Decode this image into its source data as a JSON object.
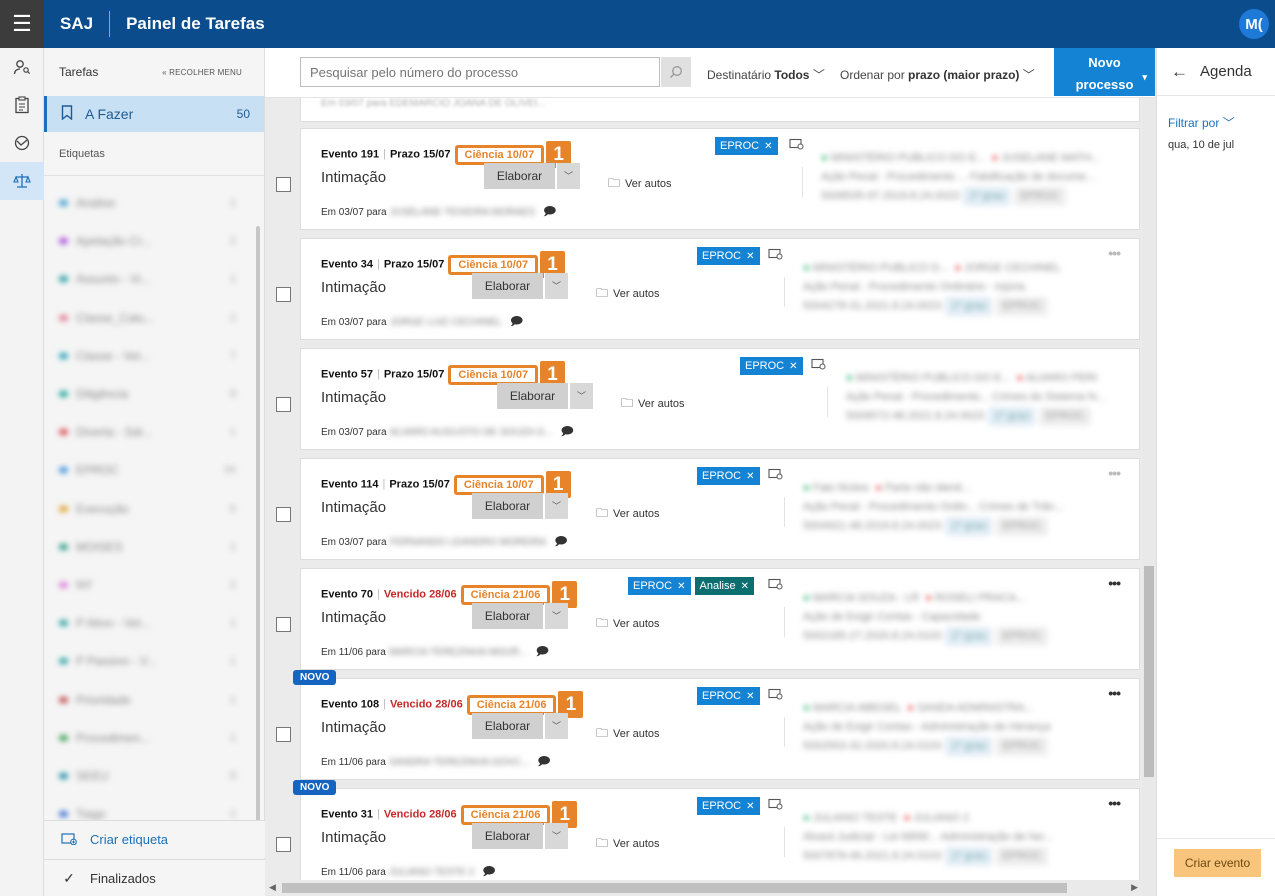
{
  "header": {
    "brand": "SAJ",
    "title": "Painel de Tarefas",
    "avatar": "M("
  },
  "sidebar": {
    "tarefas_label": "Tarefas",
    "collapse_label": "RECOLHER MENU",
    "todo": {
      "label": "A Fazer",
      "count": "50"
    },
    "etiquetas_label": "Etiquetas",
    "tags": [
      {
        "name": "Analise",
        "count": "1",
        "color": "#3f9bd1"
      },
      {
        "name": "Apelação Cr...",
        "count": "2",
        "color": "#a64bd8"
      },
      {
        "name": "Assunto - Vi...",
        "count": "1",
        "color": "#1a9aa3"
      },
      {
        "name": "Classe_Calu...",
        "count": "1",
        "color": "#e07a8a"
      },
      {
        "name": "Classe - Vel...",
        "count": "7",
        "color": "#22a0b0"
      },
      {
        "name": "Diligência",
        "count": "8",
        "color": "#1aa398"
      },
      {
        "name": "Diverta - Sál...",
        "count": "1",
        "color": "#d94a4a"
      },
      {
        "name": "EPROC",
        "count": "34",
        "color": "#3d8fe0"
      },
      {
        "name": "Execução",
        "count": "6",
        "color": "#e2a02a"
      },
      {
        "name": "MOISES",
        "count": "1",
        "color": "#2a9a8a"
      },
      {
        "name": "NY",
        "count": "2",
        "color": "#e07ad8"
      },
      {
        "name": "P Ativo - Vel...",
        "count": "1",
        "color": "#2aa0a0"
      },
      {
        "name": "P Passivo - V...",
        "count": "1",
        "color": "#2aa0a0"
      },
      {
        "name": "Prioridade",
        "count": "1",
        "color": "#c04848"
      },
      {
        "name": "Procedimen...",
        "count": "1",
        "color": "#3aa050"
      },
      {
        "name": "SEEU",
        "count": "8",
        "color": "#1a8aa0"
      },
      {
        "name": "Tiago",
        "count": "1",
        "color": "#3a6fd0"
      }
    ],
    "create_tag": "Criar etiqueta",
    "finished": "Finalizados"
  },
  "toolbar": {
    "search_placeholder": "Pesquisar pelo número do processo",
    "dest_label": "Destinatário",
    "dest_value": "Todos",
    "order_label": "Ordenar por",
    "order_value": "prazo (maior prazo)",
    "new_line1": "Novo",
    "new_line2": "processo"
  },
  "list": {
    "prev_strip": "Em 03/07 para EDEMARCIO JOANA DE OLIVEI...",
    "cards": [
      {
        "evento": "Evento 191",
        "prazo": "Prazo 15/07",
        "ciencia": "Ciência 10/07",
        "badge": "1",
        "title": "Intimação",
        "elaborar": "Elaborar",
        "ver_autos": "Ver autos",
        "em": "Em 03/07 para",
        "recipient": "JUSELANE TEIXEIRA MORAES",
        "chips": [
          "EPROC"
        ],
        "info1": "MINISTÉRIO PUBLICO DO E...",
        "info2": "JUSELANE MATH...",
        "info3": "Ação Penal - Procedimento ... Falsificação de docume...",
        "info4": "5008535-97.2019.8.24.0023",
        "pill1": "1º grau",
        "pill2": "EPROC"
      },
      {
        "evento": "Evento 34",
        "prazo": "Prazo 15/07",
        "ciencia": "Ciência 10/07",
        "badge": "1",
        "title": "Intimação",
        "elaborar": "Elaborar",
        "ver_autos": "Ver autos",
        "em": "Em 03/07 para",
        "recipient": "JORGE LUIZ CECHINEL",
        "chips": [
          "EPROC"
        ],
        "info1": "MINISTÉRIO PUBLICO D...",
        "info2": "JORGE CECHINEL",
        "info3": "Ação Penal - Procedimento Ordinário - Injúria",
        "info4": "5004278-31.2021.8.24.0023",
        "pill1": "1º grau",
        "pill2": "EPROC"
      },
      {
        "evento": "Evento 57",
        "prazo": "Prazo 15/07",
        "ciencia": "Ciência 10/07",
        "badge": "1",
        "title": "Intimação",
        "elaborar": "Elaborar",
        "ver_autos": "Ver autos",
        "em": "Em 03/07 para",
        "recipient": "ALVARO AUGUSTO DE SOUZA O...",
        "chips": [
          "EPROC"
        ],
        "info1": "MINISTÉRIO PUBLICO DO E...",
        "info2": "ALVARO PERI",
        "info3": "Ação Penal - Procedimento... Crimes do Sistema N...",
        "info4": "5009572-48.2021.8.24.0023",
        "pill1": "1º grau",
        "pill2": "EPROC"
      },
      {
        "evento": "Evento 114",
        "prazo": "Prazo 15/07",
        "ciencia": "Ciência 10/07",
        "badge": "1",
        "title": "Intimação",
        "elaborar": "Elaborar",
        "ver_autos": "Ver autos",
        "em": "Em 03/07 para",
        "recipient": "FERNANDO LEANDRO MOREIRA",
        "chips": [
          "EPROC"
        ],
        "info1": "Fato Ilícitos",
        "info2": "Parte não identi...",
        "info3": "Ação Penal - Procedimento Ordin... Crimes de Trân...",
        "info4": "5004921-48.2019.8.24.0023",
        "pill1": "1º grau",
        "pill2": "EPROC"
      },
      {
        "evento": "Evento 70",
        "prazo": "Vencido 28/06",
        "ciencia": "Ciência 21/06",
        "badge": "1",
        "title": "Intimação",
        "elaborar": "Elaborar",
        "ver_autos": "Ver autos",
        "em": "Em 11/06 para",
        "recipient": "MARCIA TEREZINHA MOUR...",
        "chips": [
          "EPROC",
          "Analise"
        ],
        "info1": "MARCIA SOUZA - LR",
        "info2": "ROSELI PRACA...",
        "info3": "Ação de Exigir Contas - Capacidade",
        "info4": "5002185-27.2020.8.24.0103",
        "pill1": "1º grau",
        "pill2": "EPROC"
      },
      {
        "evento": "Evento 108",
        "prazo": "Vencido 28/06",
        "ciencia": "Ciência 21/06",
        "badge": "1",
        "title": "Intimação",
        "elaborar": "Elaborar",
        "ver_autos": "Ver autos",
        "em": "Em 11/06 para",
        "recipient": "SANDRA TEREZINHA GOVC...",
        "chips": [
          "EPROC"
        ],
        "info1": "MARCIA ABEGEL",
        "info2": "SANDA ADMINISTRA...",
        "info3": "Ação de Exigir Contas - Administração de Herança",
        "info4": "5002553-32.2020.8.24.0103",
        "pill1": "1º grau",
        "pill2": "EPROC",
        "novo": "NOVO"
      },
      {
        "evento": "Evento 31",
        "prazo": "Vencido 28/06",
        "ciencia": "Ciência 21/06",
        "badge": "1",
        "title": "Intimação",
        "elaborar": "Elaborar",
        "ver_autos": "Ver autos",
        "em": "Em 11/06 para",
        "recipient": "JULIANO TESTE 2",
        "chips": [
          "EPROC"
        ],
        "info1": "JULIANO TESTE",
        "info2": "JULIANO 2",
        "info3": "Alvará Judicial - Lei 6858/... Administração de her...",
        "info4": "5007878-46.2021.8.24.0103",
        "pill1": "1º grau",
        "pill2": "EPROC",
        "novo": "NOVO"
      }
    ]
  },
  "agenda": {
    "title": "Agenda",
    "filter": "Filtrar por",
    "date": "qua, 10 de jul",
    "create_event": "Criar evento"
  }
}
